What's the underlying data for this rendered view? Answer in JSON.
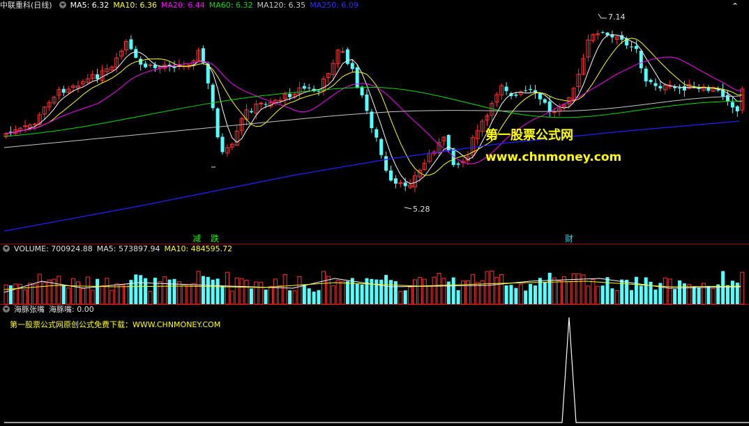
{
  "price_header": {
    "title": "中联重科(日线)",
    "ma5": "MA5: 6.32",
    "ma10": "MA10: 6.36",
    "ma20": "MA20: 6.44",
    "ma60": "MA60: 6.32",
    "ma120": "MA120: 6.35",
    "ma250": "MA250: 6.09"
  },
  "price_labels": {
    "high": "7.14",
    "low": "5.28"
  },
  "annotations": {
    "jian": "减",
    "die": "跌",
    "cai": "财"
  },
  "watermark": {
    "site_name": "第一股票公式网",
    "url": "www.chnmoney.com"
  },
  "volume_header": {
    "volume": "VOLUME: 700924.88",
    "ma5": "MA5: 573897.94",
    "ma10": "MA10: 484595.72"
  },
  "indicator_header": {
    "name": "海豚张嘴",
    "value": "海豚嘴: 0.00",
    "note": "第一股票公式网原创公式免费下载：WWW.CHNMONEY.COM"
  },
  "colors": {
    "up": "#ff3232",
    "down": "#54ffff",
    "ma5": "#ffffff",
    "ma10": "#ffff00",
    "ma20": "#ff00ff",
    "ma60": "#00e000",
    "ma120": "#c8c8c8",
    "ma250": "#2020ff",
    "separator": "#b00000"
  }
}
